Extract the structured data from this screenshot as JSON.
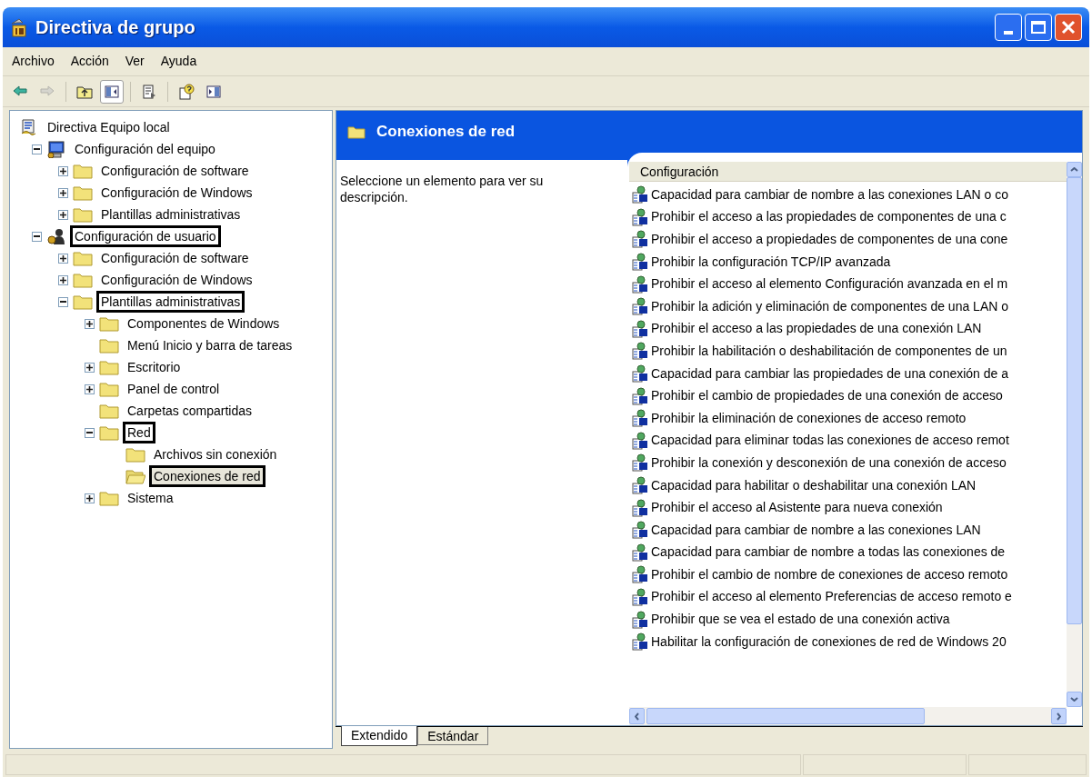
{
  "window": {
    "title": "Directiva de grupo"
  },
  "menu": [
    "Archivo",
    "Acción",
    "Ver",
    "Ayuda"
  ],
  "toolbar": [
    {
      "disabled": false,
      "pressed": false
    },
    {
      "disabled": true,
      "pressed": false
    },
    {
      "disabled": false,
      "pressed": false
    },
    {
      "disabled": false,
      "pressed": true
    },
    {
      "disabled": false,
      "pressed": false
    },
    {
      "disabled": false,
      "pressed": false
    },
    {
      "disabled": false,
      "pressed": false
    }
  ],
  "tree": [
    {
      "label": "Directiva Equipo local",
      "kind": "policy-root",
      "selected": false,
      "highlighted": false,
      "children": [
        {
          "label": "Configuración del equipo",
          "kind": "computer",
          "expandable": true,
          "expanded": true,
          "selected": false,
          "highlighted": false,
          "children": [
            {
              "label": "Configuración de software",
              "kind": "folder",
              "expandable": true,
              "expanded": false,
              "selected": false,
              "highlighted": false
            },
            {
              "label": "Configuración de Windows",
              "kind": "folder",
              "expandable": true,
              "expanded": false,
              "selected": false,
              "highlighted": false
            },
            {
              "label": "Plantillas administrativas",
              "kind": "folder",
              "expandable": true,
              "expanded": false,
              "selected": false,
              "highlighted": false
            }
          ]
        },
        {
          "label": "Configuración de usuario",
          "kind": "user",
          "expandable": true,
          "expanded": true,
          "selected": false,
          "highlighted": true,
          "children": [
            {
              "label": "Configuración de software",
              "kind": "folder",
              "expandable": true,
              "expanded": false,
              "selected": false,
              "highlighted": false
            },
            {
              "label": "Configuración de Windows",
              "kind": "folder",
              "expandable": true,
              "expanded": false,
              "selected": false,
              "highlighted": false
            },
            {
              "label": "Plantillas administrativas",
              "kind": "folder",
              "expandable": true,
              "expanded": true,
              "selected": false,
              "highlighted": true,
              "children": [
                {
                  "label": "Componentes de Windows",
                  "kind": "folder",
                  "expandable": true,
                  "expanded": false,
                  "selected": false,
                  "highlighted": false
                },
                {
                  "label": "Menú Inicio y barra de tareas",
                  "kind": "folder",
                  "expandable": false,
                  "selected": false,
                  "highlighted": false
                },
                {
                  "label": "Escritorio",
                  "kind": "folder",
                  "expandable": true,
                  "expanded": false,
                  "selected": false,
                  "highlighted": false
                },
                {
                  "label": "Panel de control",
                  "kind": "folder",
                  "expandable": true,
                  "expanded": false,
                  "selected": false,
                  "highlighted": false
                },
                {
                  "label": "Carpetas compartidas",
                  "kind": "folder",
                  "expandable": false,
                  "selected": false,
                  "highlighted": false
                },
                {
                  "label": "Red",
                  "kind": "folder",
                  "expandable": true,
                  "expanded": true,
                  "selected": false,
                  "highlighted": true,
                  "children": [
                    {
                      "label": "Archivos sin conexión",
                      "kind": "folder",
                      "expandable": false,
                      "selected": false,
                      "highlighted": false
                    },
                    {
                      "label": "Conexiones de red",
                      "kind": "open-folder",
                      "expandable": false,
                      "selected": true,
                      "highlighted": true
                    }
                  ]
                },
                {
                  "label": "Sistema",
                  "kind": "folder",
                  "expandable": true,
                  "expanded": false,
                  "selected": false,
                  "highlighted": false
                }
              ]
            }
          ]
        }
      ]
    }
  ],
  "details": {
    "title": "Conexiones de red",
    "description": "Seleccione un elemento para ver su descripción.",
    "column": "Configuración",
    "rows": [
      "Capacidad para cambiar de nombre a las conexiones LAN o co",
      "Prohibir el acceso a las propiedades de componentes de una c",
      "Prohibir el acceso a propiedades de componentes de una cone",
      "Prohibir la configuración TCP/IP avanzada",
      "Prohibir el acceso al elemento Configuración avanzada en el m",
      "Prohibir la adición y eliminación de componentes de una LAN o",
      "Prohibir el acceso a las propiedades de una conexión LAN",
      "Prohibir la habilitación o deshabilitación de componentes de un",
      "Capacidad para cambiar las propiedades de una conexión de a",
      "Prohibir el cambio de propiedades de una conexión de acceso",
      "Prohibir la eliminación de conexiones de acceso remoto",
      "Capacidad para eliminar todas las conexiones de acceso remot",
      "Prohibir la conexión y desconexión de una conexión de acceso",
      "Capacidad para habilitar o deshabilitar una conexión LAN",
      "Prohibir el acceso al Asistente para nueva conexión",
      "Capacidad para cambiar de nombre a las conexiones LAN",
      "Capacidad para cambiar de nombre a todas las conexiones de",
      "Prohibir el cambio de nombre de conexiones de acceso remoto",
      "Prohibir el acceso al elemento Preferencias de acceso remoto e",
      "Prohibir que se vea el estado de una conexión activa",
      "Habilitar la configuración de conexiones de red de Windows 20"
    ]
  },
  "view_tabs": [
    {
      "label": "Extendido",
      "selected": true
    },
    {
      "label": "Estándar",
      "selected": false
    }
  ]
}
